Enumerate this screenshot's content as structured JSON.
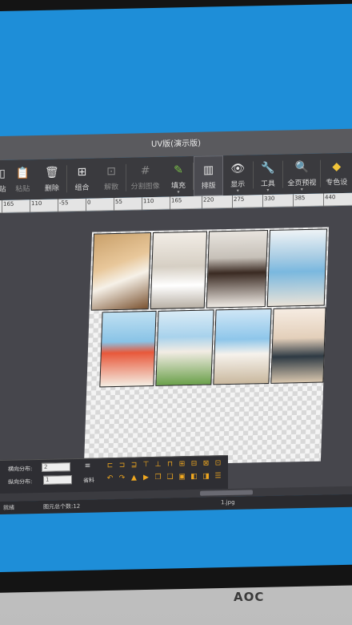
{
  "window": {
    "title": "UV版(演示版)"
  },
  "toolbar": {
    "items": [
      {
        "label": "贴",
        "icon": "paste-partial-icon"
      },
      {
        "label": "粘贴",
        "icon": "clipboard-icon"
      },
      {
        "label": "删除",
        "icon": "trash-icon"
      },
      {
        "label": "组合",
        "icon": "group-icon"
      },
      {
        "label": "解散",
        "icon": "ungroup-icon"
      },
      {
        "label": "分割图像",
        "icon": "grid-split-icon"
      },
      {
        "label": "填充",
        "icon": "fill-pen-icon"
      },
      {
        "label": "排版",
        "icon": "layout-icon"
      },
      {
        "label": "显示",
        "icon": "eye-icon"
      },
      {
        "label": "工具",
        "icon": "wrench-icon"
      },
      {
        "label": "全页预视",
        "icon": "preview-icon"
      },
      {
        "label": "专色设",
        "icon": "spot-color-icon"
      }
    ]
  },
  "ruler": {
    "labels": [
      "165",
      "110",
      "-55",
      "0",
      "55",
      "110",
      "165",
      "220",
      "275",
      "330",
      "385",
      "440"
    ]
  },
  "bottom_panel": {
    "horizontal_label": "横向分布:",
    "horizontal_value": "2",
    "vertical_label": "纵向分布:",
    "vertical_value": "1",
    "save_material_label": "省料"
  },
  "status": {
    "left": "就绪",
    "count": "图元总个数:12",
    "file": "1.jpg"
  },
  "monitor": {
    "brand": "AOC"
  }
}
